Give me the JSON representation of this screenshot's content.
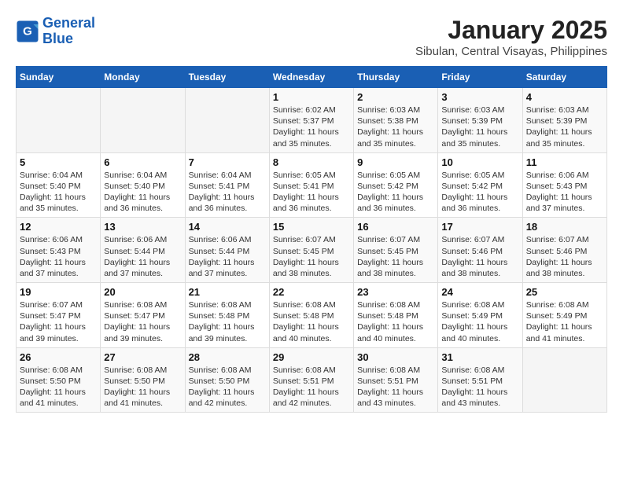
{
  "logo": {
    "text_general": "General",
    "text_blue": "Blue"
  },
  "title": "January 2025",
  "subtitle": "Sibulan, Central Visayas, Philippines",
  "days_of_week": [
    "Sunday",
    "Monday",
    "Tuesday",
    "Wednesday",
    "Thursday",
    "Friday",
    "Saturday"
  ],
  "weeks": [
    [
      {
        "day": "",
        "info": ""
      },
      {
        "day": "",
        "info": ""
      },
      {
        "day": "",
        "info": ""
      },
      {
        "day": "1",
        "info": "Sunrise: 6:02 AM\nSunset: 5:37 PM\nDaylight: 11 hours\nand 35 minutes."
      },
      {
        "day": "2",
        "info": "Sunrise: 6:03 AM\nSunset: 5:38 PM\nDaylight: 11 hours\nand 35 minutes."
      },
      {
        "day": "3",
        "info": "Sunrise: 6:03 AM\nSunset: 5:39 PM\nDaylight: 11 hours\nand 35 minutes."
      },
      {
        "day": "4",
        "info": "Sunrise: 6:03 AM\nSunset: 5:39 PM\nDaylight: 11 hours\nand 35 minutes."
      }
    ],
    [
      {
        "day": "5",
        "info": "Sunrise: 6:04 AM\nSunset: 5:40 PM\nDaylight: 11 hours\nand 35 minutes."
      },
      {
        "day": "6",
        "info": "Sunrise: 6:04 AM\nSunset: 5:40 PM\nDaylight: 11 hours\nand 36 minutes."
      },
      {
        "day": "7",
        "info": "Sunrise: 6:04 AM\nSunset: 5:41 PM\nDaylight: 11 hours\nand 36 minutes."
      },
      {
        "day": "8",
        "info": "Sunrise: 6:05 AM\nSunset: 5:41 PM\nDaylight: 11 hours\nand 36 minutes."
      },
      {
        "day": "9",
        "info": "Sunrise: 6:05 AM\nSunset: 5:42 PM\nDaylight: 11 hours\nand 36 minutes."
      },
      {
        "day": "10",
        "info": "Sunrise: 6:05 AM\nSunset: 5:42 PM\nDaylight: 11 hours\nand 36 minutes."
      },
      {
        "day": "11",
        "info": "Sunrise: 6:06 AM\nSunset: 5:43 PM\nDaylight: 11 hours\nand 37 minutes."
      }
    ],
    [
      {
        "day": "12",
        "info": "Sunrise: 6:06 AM\nSunset: 5:43 PM\nDaylight: 11 hours\nand 37 minutes."
      },
      {
        "day": "13",
        "info": "Sunrise: 6:06 AM\nSunset: 5:44 PM\nDaylight: 11 hours\nand 37 minutes."
      },
      {
        "day": "14",
        "info": "Sunrise: 6:06 AM\nSunset: 5:44 PM\nDaylight: 11 hours\nand 37 minutes."
      },
      {
        "day": "15",
        "info": "Sunrise: 6:07 AM\nSunset: 5:45 PM\nDaylight: 11 hours\nand 38 minutes."
      },
      {
        "day": "16",
        "info": "Sunrise: 6:07 AM\nSunset: 5:45 PM\nDaylight: 11 hours\nand 38 minutes."
      },
      {
        "day": "17",
        "info": "Sunrise: 6:07 AM\nSunset: 5:46 PM\nDaylight: 11 hours\nand 38 minutes."
      },
      {
        "day": "18",
        "info": "Sunrise: 6:07 AM\nSunset: 5:46 PM\nDaylight: 11 hours\nand 38 minutes."
      }
    ],
    [
      {
        "day": "19",
        "info": "Sunrise: 6:07 AM\nSunset: 5:47 PM\nDaylight: 11 hours\nand 39 minutes."
      },
      {
        "day": "20",
        "info": "Sunrise: 6:08 AM\nSunset: 5:47 PM\nDaylight: 11 hours\nand 39 minutes."
      },
      {
        "day": "21",
        "info": "Sunrise: 6:08 AM\nSunset: 5:48 PM\nDaylight: 11 hours\nand 39 minutes."
      },
      {
        "day": "22",
        "info": "Sunrise: 6:08 AM\nSunset: 5:48 PM\nDaylight: 11 hours\nand 40 minutes."
      },
      {
        "day": "23",
        "info": "Sunrise: 6:08 AM\nSunset: 5:48 PM\nDaylight: 11 hours\nand 40 minutes."
      },
      {
        "day": "24",
        "info": "Sunrise: 6:08 AM\nSunset: 5:49 PM\nDaylight: 11 hours\nand 40 minutes."
      },
      {
        "day": "25",
        "info": "Sunrise: 6:08 AM\nSunset: 5:49 PM\nDaylight: 11 hours\nand 41 minutes."
      }
    ],
    [
      {
        "day": "26",
        "info": "Sunrise: 6:08 AM\nSunset: 5:50 PM\nDaylight: 11 hours\nand 41 minutes."
      },
      {
        "day": "27",
        "info": "Sunrise: 6:08 AM\nSunset: 5:50 PM\nDaylight: 11 hours\nand 41 minutes."
      },
      {
        "day": "28",
        "info": "Sunrise: 6:08 AM\nSunset: 5:50 PM\nDaylight: 11 hours\nand 42 minutes."
      },
      {
        "day": "29",
        "info": "Sunrise: 6:08 AM\nSunset: 5:51 PM\nDaylight: 11 hours\nand 42 minutes."
      },
      {
        "day": "30",
        "info": "Sunrise: 6:08 AM\nSunset: 5:51 PM\nDaylight: 11 hours\nand 43 minutes."
      },
      {
        "day": "31",
        "info": "Sunrise: 6:08 AM\nSunset: 5:51 PM\nDaylight: 11 hours\nand 43 minutes."
      },
      {
        "day": "",
        "info": ""
      }
    ]
  ]
}
